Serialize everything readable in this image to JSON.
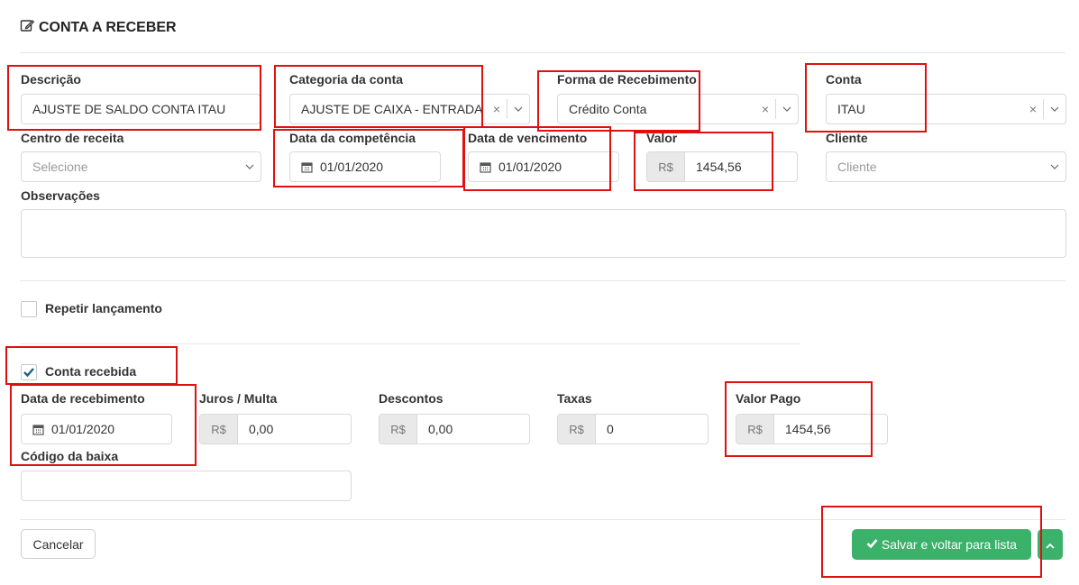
{
  "header": {
    "title": "CONTA A RECEBER",
    "icon": "edit-icon"
  },
  "fields": {
    "descricao": {
      "label": "Descrição",
      "value": "AJUSTE DE SALDO CONTA ITAU"
    },
    "categoria": {
      "label": "Categoria da conta",
      "value": "AJUSTE DE CAIXA - ENTRADA"
    },
    "forma": {
      "label": "Forma de Recebimento",
      "value": "Crédito Conta"
    },
    "conta": {
      "label": "Conta",
      "value": "ITAU"
    },
    "centro": {
      "label": "Centro de receita",
      "placeholder": "Selecione"
    },
    "competencia": {
      "label": "Data da competência",
      "value": "01/01/2020"
    },
    "vencimento": {
      "label": "Data de vencimento",
      "value": "01/01/2020"
    },
    "valor": {
      "label": "Valor",
      "prefix": "R$",
      "value": "1454,56"
    },
    "cliente": {
      "label": "Cliente",
      "placeholder": "Cliente"
    },
    "observacoes": {
      "label": "Observações",
      "value": ""
    }
  },
  "repetir": {
    "label": "Repetir lançamento",
    "checked": false
  },
  "recebida": {
    "label": "Conta recebida",
    "checked": true
  },
  "recebimento": {
    "data": {
      "label": "Data de recebimento",
      "value": "01/01/2020"
    },
    "juros": {
      "label": "Juros / Multa",
      "prefix": "R$",
      "value": "0,00"
    },
    "descontos": {
      "label": "Descontos",
      "prefix": "R$",
      "value": "0,00"
    },
    "taxas": {
      "label": "Taxas",
      "prefix": "R$",
      "value": "0"
    },
    "valor_pago": {
      "label": "Valor Pago",
      "prefix": "R$",
      "value": "1454,56"
    },
    "codigo": {
      "label": "Código da baixa",
      "value": ""
    }
  },
  "footer": {
    "cancel_label": "Cancelar",
    "save_label": "Salvar e voltar para lista"
  },
  "colors": {
    "accent": "#3bb16a",
    "highlight": "#e01010",
    "check": "#1f5f7a"
  }
}
